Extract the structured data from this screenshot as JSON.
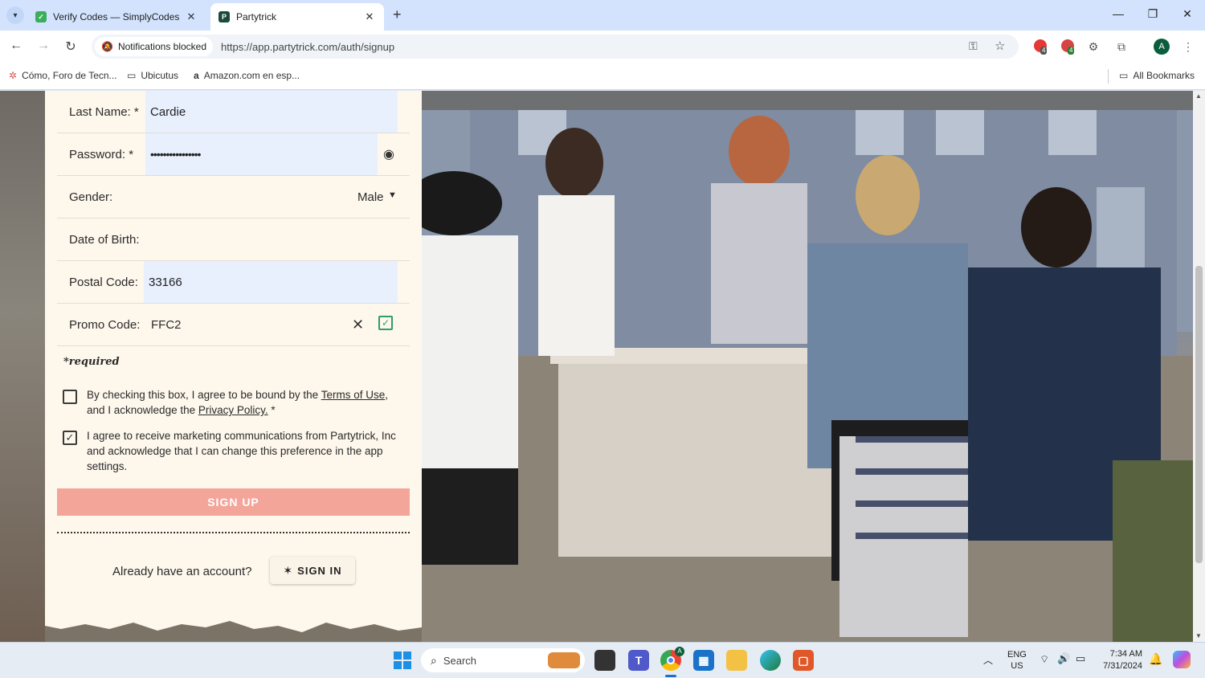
{
  "browser": {
    "tabs": [
      {
        "title": "Verify Codes — SimplyCodes",
        "active": false
      },
      {
        "title": "Partytrick",
        "active": true
      }
    ],
    "new_tab": "+",
    "notifications_chip": "Notifications blocked",
    "url": "https://app.partytrick.com/auth/signup",
    "profile_initial": "A",
    "extension_badges": [
      "4",
      "4"
    ],
    "bookmarks": [
      {
        "label": "Cómo, Foro de Tecn...",
        "icon": "web-icon"
      },
      {
        "label": "Ubicutus",
        "icon": "folder-icon"
      },
      {
        "label": "Amazon.com en esp...",
        "icon": "amazon-icon"
      }
    ],
    "all_bookmarks": "All Bookmarks"
  },
  "form": {
    "last_name_label": "Last Name: *",
    "last_name_value": "Cardie",
    "password_label": "Password: *",
    "password_value": "••••••••••••••••",
    "gender_label": "Gender:",
    "gender_value": "Male",
    "dob_label": "Date of Birth:",
    "postal_label": "Postal Code:",
    "postal_value": "33166",
    "promo_label": "Promo Code:",
    "promo_value": "FFC2",
    "required_note": "*required",
    "terms_text_1": "By checking this box, I agree to be bound by the ",
    "terms_link": "Terms of Use",
    "terms_text_2": ", and I acknowledge the ",
    "privacy_link": "Privacy Policy.",
    "terms_required": " *",
    "terms_checked": false,
    "marketing_text": "I agree to receive marketing communications from Partytrick, Inc and acknowledge that I can change this preference in the app settings.",
    "marketing_checked": true,
    "signup_button": "SIGN UP",
    "already_text": "Already have an account?",
    "signin_button": "SIGN IN"
  },
  "taskbar": {
    "search_placeholder": "Search",
    "lang_1": "ENG",
    "lang_2": "US",
    "time": "7:34 AM",
    "date": "7/31/2024",
    "chrome_badge": "A"
  },
  "colors": {
    "accent": "#f4a59a",
    "panel_bg": "#fdf7ec",
    "autofill_bg": "#e8f0fe",
    "check_green": "#2e9e6a"
  }
}
